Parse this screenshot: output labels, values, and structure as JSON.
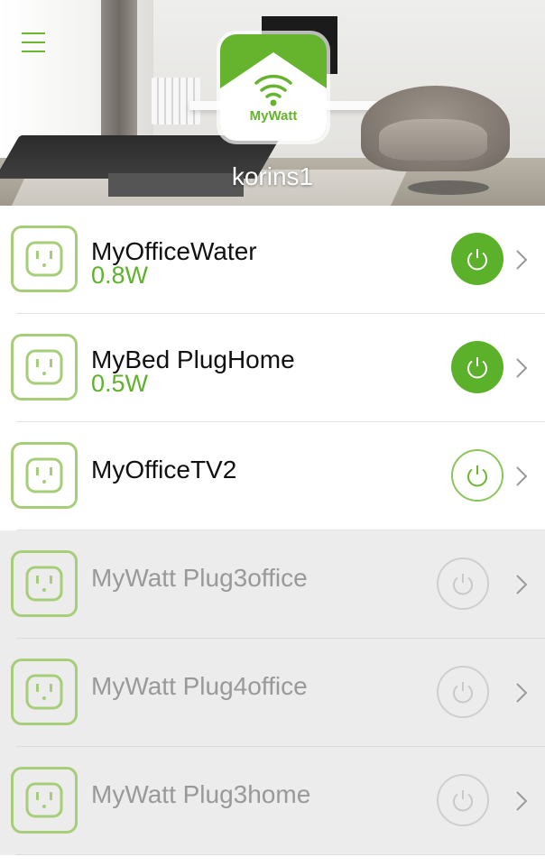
{
  "header": {
    "app_name": "MyWatt",
    "username": "korins1"
  },
  "colors": {
    "accent": "#5bb12a",
    "outlet_border": "#a6cd78",
    "offline_bg": "#ececec"
  },
  "devices": [
    {
      "name": "MyOfficeWater",
      "power": "0.8W",
      "state": "on"
    },
    {
      "name": "MyBed PlugHome",
      "power": "0.5W",
      "state": "on"
    },
    {
      "name": "MyOfficeTV2",
      "power": "",
      "state": "off"
    },
    {
      "name": "MyWatt Plug3office",
      "power": "",
      "state": "offline"
    },
    {
      "name": "MyWatt Plug4office",
      "power": "",
      "state": "offline"
    },
    {
      "name": "MyWatt Plug3home",
      "power": "",
      "state": "offline"
    }
  ],
  "icons": {
    "menu": "hamburger-menu-icon",
    "outlet": "power-outlet-icon",
    "power": "power-icon",
    "chevron": "chevron-right-icon"
  }
}
